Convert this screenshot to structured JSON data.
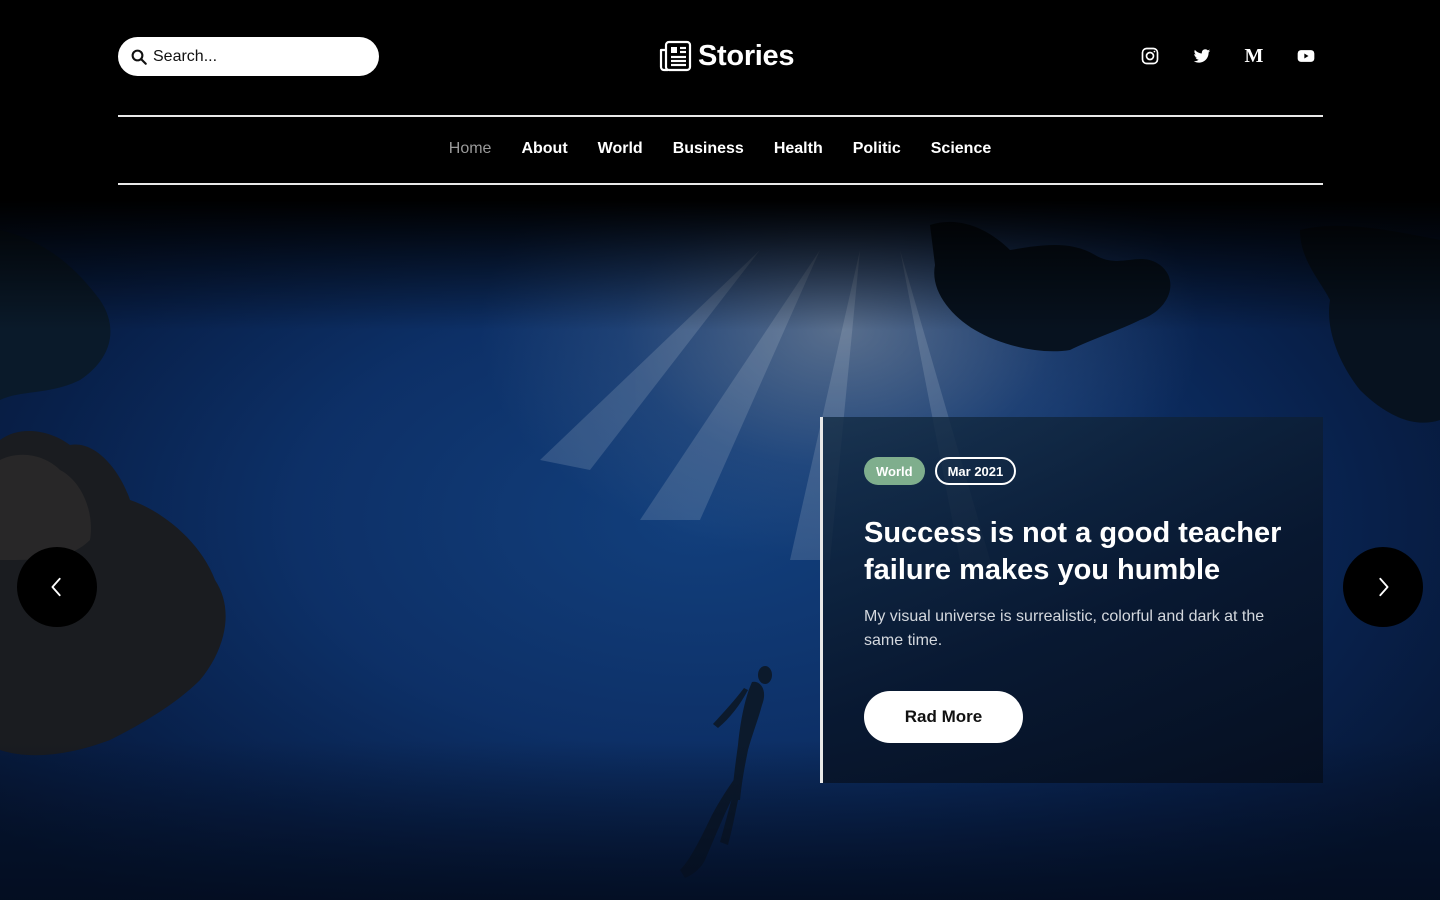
{
  "header": {
    "search": {
      "placeholder": "Search..."
    },
    "logo": {
      "text": "Stories",
      "icon": "newspaper-icon"
    },
    "socials": [
      {
        "name": "instagram",
        "icon": "instagram-icon"
      },
      {
        "name": "twitter",
        "icon": "twitter-icon"
      },
      {
        "name": "medium",
        "icon": "medium-icon",
        "glyph": "M"
      },
      {
        "name": "youtube",
        "icon": "youtube-icon"
      }
    ]
  },
  "nav": {
    "items": [
      {
        "label": "Home",
        "active": true
      },
      {
        "label": "About"
      },
      {
        "label": "World"
      },
      {
        "label": "Business"
      },
      {
        "label": "Health"
      },
      {
        "label": "Politic"
      },
      {
        "label": "Science"
      }
    ]
  },
  "hero": {
    "category": "World",
    "date": "Mar 2021",
    "title": "Success is not a good teacher failure makes you humble",
    "description": "My visual universe is surrealistic, colorful and dark at the same time.",
    "cta_label": "Rad More",
    "prev_icon": "chevron-left-icon",
    "next_icon": "chevron-right-icon"
  },
  "colors": {
    "background": "#000000",
    "category_badge": "#7fae8d",
    "ocean": "#0d3067",
    "nav_active": "#9a9a9a"
  }
}
